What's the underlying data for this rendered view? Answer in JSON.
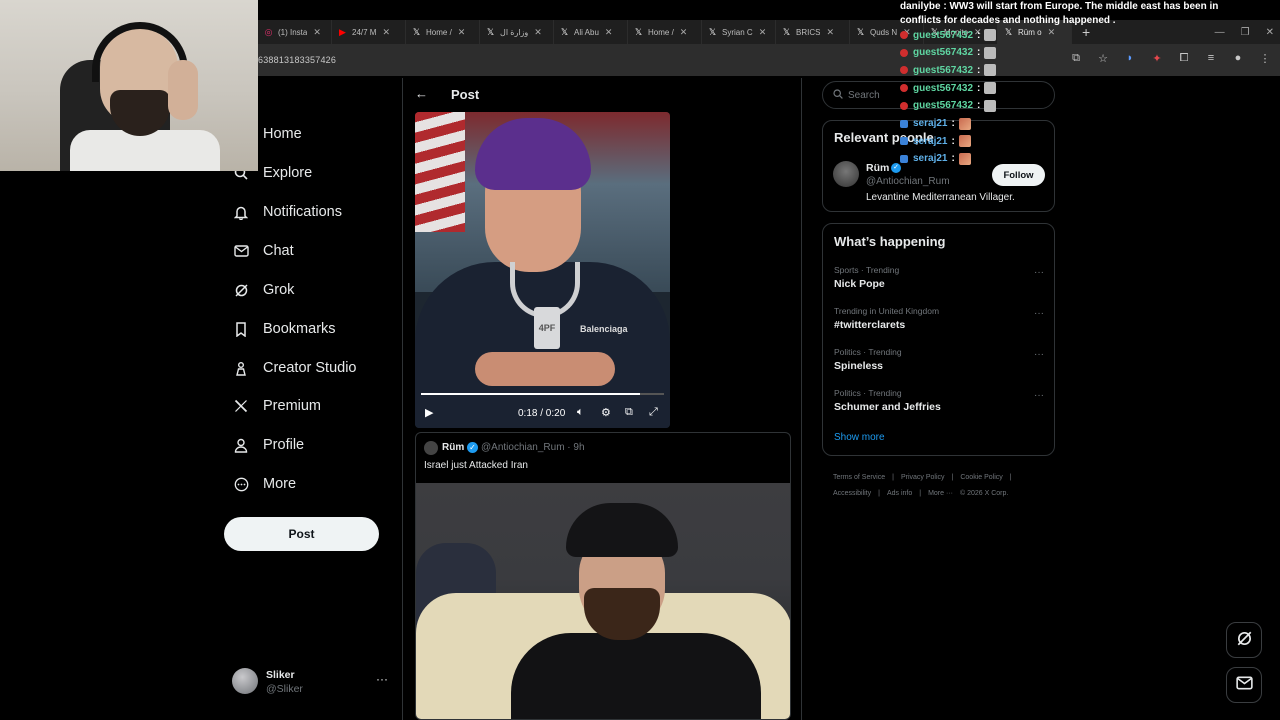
{
  "browser": {
    "tabs": [
      {
        "icon": "instagram-icon",
        "label": "(1) Insta",
        "color": "#e1306c"
      },
      {
        "icon": "youtube-icon",
        "label": "24/7 M",
        "color": "#ff0000"
      },
      {
        "icon": "x-icon",
        "label": "Home /",
        "color": "#ffffff"
      },
      {
        "icon": "x-icon",
        "label": "وزارة ال",
        "color": "#ffffff"
      },
      {
        "icon": "x-icon",
        "label": "Ali Abu",
        "color": "#ffffff"
      },
      {
        "icon": "x-icon",
        "label": "Home /",
        "color": "#ffffff"
      },
      {
        "icon": "x-icon",
        "label": "Syrian C",
        "color": "#ffffff"
      },
      {
        "icon": "x-icon",
        "label": "BRICS",
        "color": "#ffffff"
      },
      {
        "icon": "x-icon",
        "label": "Quds N",
        "color": "#ffffff"
      },
      {
        "icon": "x-icon",
        "label": "Monito",
        "color": "#ffffff"
      },
      {
        "icon": "x-icon",
        "label": "Rüm o",
        "color": "#ffffff",
        "active": true
      }
    ],
    "url_fragment": "638813183357426"
  },
  "nav": {
    "items": [
      {
        "name": "home",
        "label": "Home",
        "icon": "home-icon"
      },
      {
        "name": "explore",
        "label": "Explore",
        "icon": "search-icon"
      },
      {
        "name": "notifications",
        "label": "Notifications",
        "icon": "bell-icon"
      },
      {
        "name": "chat",
        "label": "Chat",
        "icon": "mail-icon"
      },
      {
        "name": "grok",
        "label": "Grok",
        "icon": "grok-icon"
      },
      {
        "name": "bookmarks",
        "label": "Bookmarks",
        "icon": "bookmark-icon"
      },
      {
        "name": "creator-studio",
        "label": "Creator Studio",
        "icon": "creator-icon"
      },
      {
        "name": "premium",
        "label": "Premium",
        "icon": "x-logo-icon"
      },
      {
        "name": "profile",
        "label": "Profile",
        "icon": "person-icon"
      },
      {
        "name": "more",
        "label": "More",
        "icon": "more-circle-icon"
      }
    ],
    "post_label": "Post",
    "user": {
      "name": "Sliker",
      "handle": "@Sliker"
    }
  },
  "post": {
    "header_title": "Post",
    "video": {
      "time": "0:18 / 0:20",
      "progress": 0.9,
      "brand_text": "Balenciaga",
      "pendant_text": "4PF"
    },
    "quote": {
      "name": "Rüm",
      "handle_time": "@Antiochian_Rum · 9h",
      "text": "Israel just Attacked Iran"
    }
  },
  "sidebar": {
    "search_placeholder": "Search",
    "relevant": {
      "title": "Relevant people",
      "name": "Rüm",
      "handle": "@Antiochian_Rum",
      "bio": "Levantine Mediterranean Villager.",
      "follow_label": "Follow"
    },
    "whats_happening": {
      "title": "What’s happening",
      "trends": [
        {
          "meta": "Sports · Trending",
          "name": "Nick Pope"
        },
        {
          "meta": "Trending in United Kingdom",
          "name": "#twitterclarets"
        },
        {
          "meta": "Politics · Trending",
          "name": "Spineless"
        },
        {
          "meta": "Politics · Trending",
          "name": "Schumer and Jeffries"
        }
      ],
      "show_more": "Show more"
    },
    "footer": [
      "Terms of Service",
      "|",
      "Privacy Policy",
      "|",
      "Cookie Policy",
      "|",
      "Accessibility",
      "|",
      "Ads info",
      "|",
      "More ···",
      "© 2026 X Corp."
    ]
  },
  "chat": {
    "top_line1": "danilybe : WW3 will start from Europe. The middle east has been in",
    "top_line2": "conflicts for decades and nothing happened .",
    "messages": [
      {
        "user": "guest567432",
        "badge": "red",
        "emote": "plain"
      },
      {
        "user": "guest567432",
        "badge": "red",
        "emote": "plain"
      },
      {
        "user": "guest567432",
        "badge": "red",
        "emote": "plain"
      },
      {
        "user": "guest567432",
        "badge": "red",
        "emote": "plain"
      },
      {
        "user": "guest567432",
        "badge": "red",
        "emote": "plain"
      },
      {
        "user": "seraj21",
        "badge": "blue",
        "emote": "pic"
      },
      {
        "user": "seraj21",
        "badge": "blue",
        "emote": "pic"
      },
      {
        "user": "seraj21",
        "badge": "blue",
        "emote": "pic"
      }
    ]
  }
}
